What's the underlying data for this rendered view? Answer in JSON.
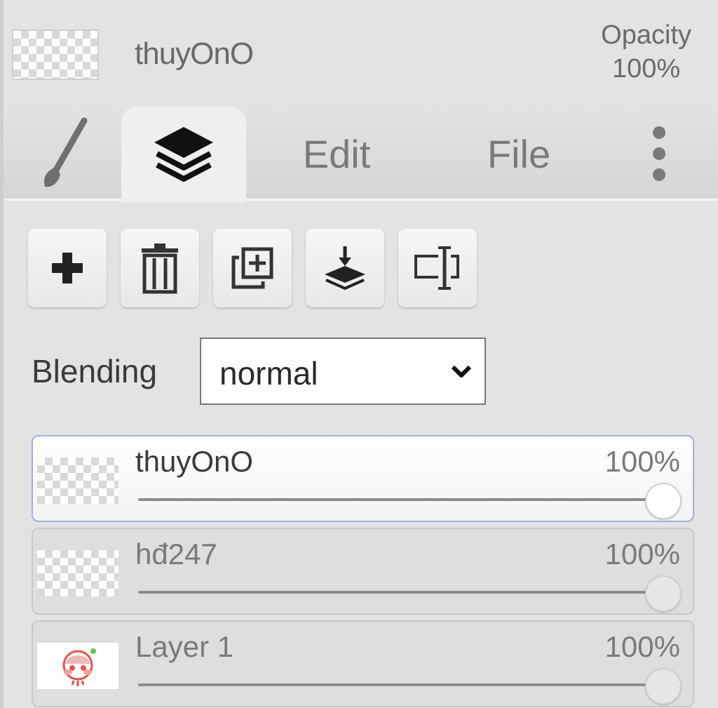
{
  "header": {
    "layer_name": "thuyOnO",
    "opacity_label": "Opacity",
    "opacity_value": "100%"
  },
  "tabs": [
    {
      "id": "brush",
      "icon": "brush-icon",
      "label": ""
    },
    {
      "id": "layers",
      "icon": "layers-icon",
      "label": "",
      "active": true
    },
    {
      "id": "edit",
      "label": "Edit"
    },
    {
      "id": "file",
      "label": "File"
    },
    {
      "id": "more",
      "icon": "more-vertical-icon",
      "label": ""
    }
  ],
  "toolbar": [
    {
      "icon": "plus-icon",
      "action": "add-layer"
    },
    {
      "icon": "trash-icon",
      "action": "delete-layer"
    },
    {
      "icon": "duplicate-icon",
      "action": "duplicate-layer"
    },
    {
      "icon": "merge-down-icon",
      "action": "merge-down"
    },
    {
      "icon": "rename-icon",
      "action": "rename-layer"
    }
  ],
  "blending": {
    "label": "Blending",
    "value": "normal"
  },
  "layers": [
    {
      "name": "thuyOnO",
      "opacity": "100%",
      "opacity_value": 1.0,
      "active": true,
      "thumb": "transparent"
    },
    {
      "name": "hđ247",
      "opacity": "100%",
      "opacity_value": 1.0,
      "active": false,
      "thumb": "transparent"
    },
    {
      "name": "Layer 1",
      "opacity": "100%",
      "opacity_value": 1.0,
      "active": false,
      "thumb": "image"
    }
  ],
  "colors": {
    "panel_bg": "#e3e3e3",
    "active_border": "#9db3e0",
    "text": "#3a3a3a",
    "muted_text": "#7a7a7a"
  }
}
